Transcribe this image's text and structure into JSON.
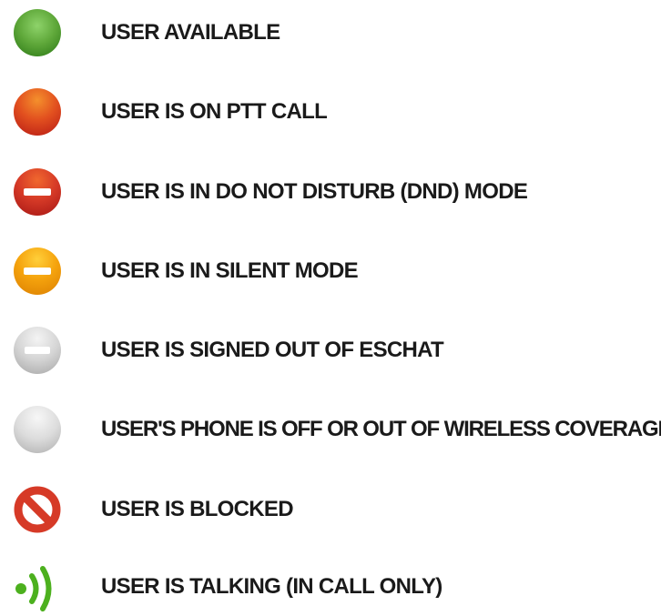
{
  "legend": {
    "items": [
      {
        "icon": "available-status-icon",
        "color": "#5fa83a",
        "label": "USER AVAILABLE"
      },
      {
        "icon": "ptt-call-status-icon",
        "color": "#e2501f",
        "label": "USER IS ON PTT CALL"
      },
      {
        "icon": "do-not-disturb-icon",
        "color": "#d63a27",
        "label": "USER IS IN DO NOT DISTURB (DND) MODE"
      },
      {
        "icon": "silent-mode-icon",
        "color": "#f5a30d",
        "label": "USER IS IN SILENT MODE"
      },
      {
        "icon": "signed-out-icon",
        "color": "#cfcfcf",
        "label": "USER IS SIGNED OUT OF ESCHAT"
      },
      {
        "icon": "offline-icon",
        "color": "#dcdcdc",
        "label": "USER'S PHONE IS OFF OR OUT OF WIRELESS COVERAGE"
      },
      {
        "icon": "blocked-icon",
        "color": "#d63a27",
        "label": "USER IS BLOCKED"
      },
      {
        "icon": "talking-icon",
        "color": "#4cb01e",
        "label": "USER IS TALKING (IN CALL ONLY)"
      }
    ]
  }
}
